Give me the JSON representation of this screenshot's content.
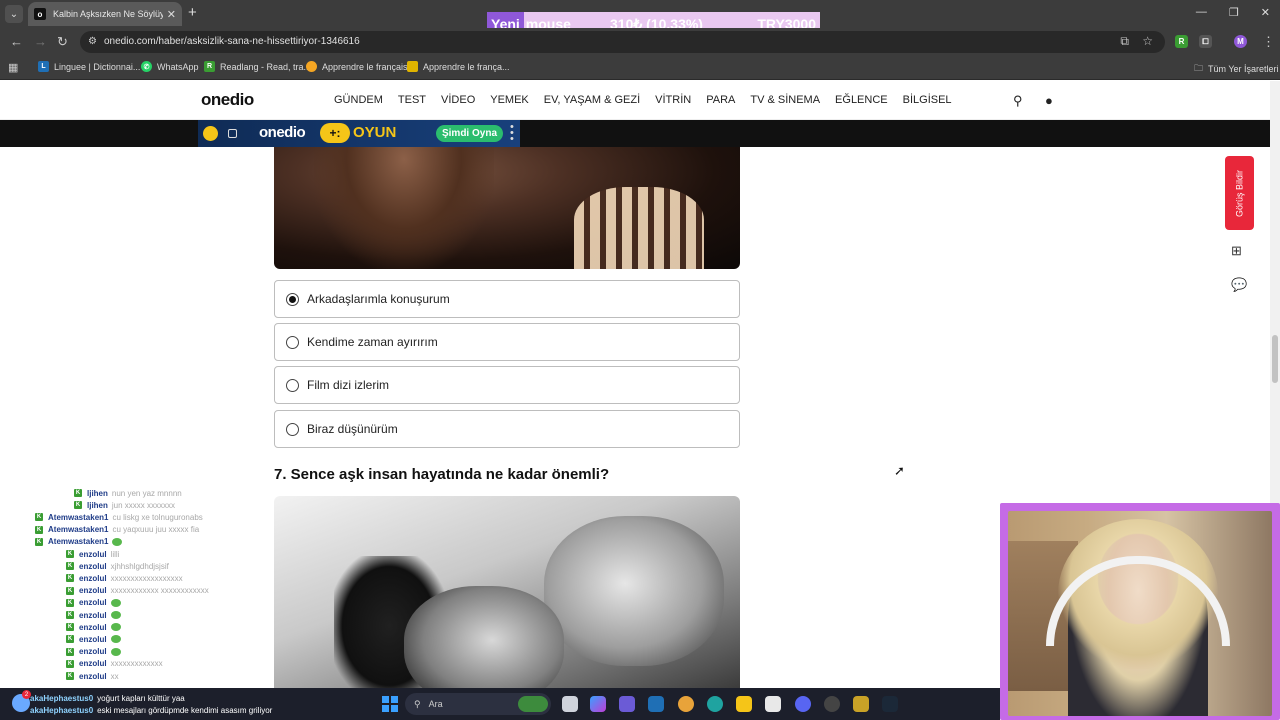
{
  "browser": {
    "tab_title": "Kalbin Aşksızken Ne Söylüyor?",
    "tab_favicon": "o",
    "new_tab_label": "+",
    "url": "onedio.com/haber/asksizlik-sana-ne-hissettiriyor-1346616",
    "bookmarks": [
      {
        "label": "Linguee | Dictionnai...",
        "icon": "linguee-icon",
        "color": "#1f6fb5"
      },
      {
        "label": "WhatsApp",
        "icon": "whatsapp-icon",
        "color": "#25d366"
      },
      {
        "label": "Readlang - Read, tra...",
        "icon": "readlang-icon",
        "color": "#3a9d33"
      },
      {
        "label": "Apprendre le français",
        "icon": "apprendre-icon",
        "color": "#f5a623"
      },
      {
        "label": "Apprendre le françа...",
        "icon": "apprendre2-icon",
        "color": "#e0b400"
      }
    ],
    "all_bookmarks": "Tüm Yer İşaretleri",
    "profile_initial": "M"
  },
  "ticker": {
    "label": "Yeni",
    "name": "mouse",
    "price": "310₺ (10.33%)",
    "code": "TRY3000"
  },
  "site": {
    "logo": "onedio",
    "nav": [
      "GÜNDEM",
      "TEST",
      "VİDEO",
      "YEMEK",
      "EV, YAŞAM & GEZİ",
      "VİTRİN",
      "PARA",
      "TV & SİNEMA",
      "EĞLENCE",
      "BİLGİSEL"
    ],
    "oyun": {
      "logo": "onedio",
      "plus": "+:",
      "word": "OYUN",
      "button": "Şimdi Oyna"
    },
    "feedback": "Görüş Bildir"
  },
  "quiz": {
    "options": [
      {
        "label": "Arkadaşlarımla konuşurum",
        "checked": true
      },
      {
        "label": "Kendime zaman ayırırım",
        "checked": false
      },
      {
        "label": "Film dizi izlerim",
        "checked": false
      },
      {
        "label": "Biraz düşünürüm",
        "checked": false
      }
    ],
    "next_question": "7. Sence aşk insan hayatında ne kadar önemli?"
  },
  "chat": [
    {
      "user": "ljihen",
      "msg": "nun yen yaz mnnnn",
      "indent": 2
    },
    {
      "user": "ljihen",
      "msg": "jun xxxxx xxxxxxx",
      "indent": 2
    },
    {
      "user": "Atemwastaken1",
      "msg": "cu liskg xe tolnuguronabs",
      "indent": 0
    },
    {
      "user": "Atemwastaken1",
      "msg": "cu yaqxuuu juu xxxxx fia",
      "indent": 0
    },
    {
      "user": "Atemwastaken1",
      "msg": "",
      "indent": 0,
      "emote": true
    },
    {
      "user": "enzolul",
      "msg": "lilli",
      "indent": 1
    },
    {
      "user": "enzolul",
      "msg": "xjhhshlgdhdjsjsif",
      "indent": 1
    },
    {
      "user": "enzolul",
      "msg": "xxxxxxxxxxxxxxxxxx",
      "indent": 1
    },
    {
      "user": "enzolul",
      "msg": "xxxxxxxxxxxx xxxxxxxxxxxx",
      "indent": 1
    },
    {
      "user": "enzolul",
      "msg": "",
      "indent": 1,
      "emote": true
    },
    {
      "user": "enzolul",
      "msg": "",
      "indent": 1,
      "emote": true
    },
    {
      "user": "enzolul",
      "msg": "",
      "indent": 1,
      "emote": true
    },
    {
      "user": "enzolul",
      "msg": "",
      "indent": 1,
      "emote": true
    },
    {
      "user": "enzolul",
      "msg": "",
      "indent": 1,
      "emote": true
    },
    {
      "user": "enzolul",
      "msg": "xxxxxxxxxxxxx",
      "indent": 1
    },
    {
      "user": "enzolul",
      "msg": "xx",
      "indent": 1
    }
  ],
  "taskbar": {
    "notif_count": "2",
    "lines": [
      {
        "user": "akaHephaestus0",
        "msg": "yoğurt kapları külttür yaa"
      },
      {
        "user": "akaHephaestus0",
        "msg": "eski mesajları gördüpmde kendimi asasım griliyor"
      }
    ],
    "search_placeholder": "Ara"
  }
}
